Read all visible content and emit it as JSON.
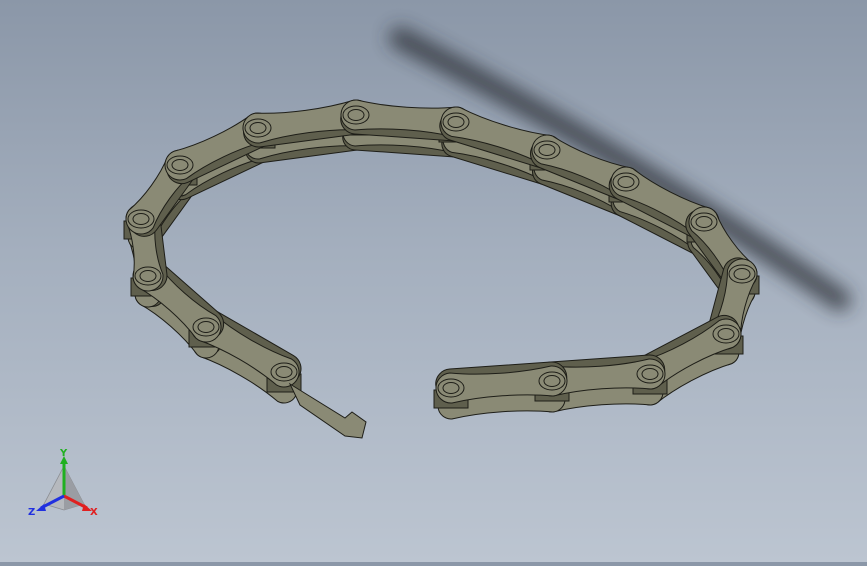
{
  "scene": {
    "model": "roller-chain",
    "links": 18,
    "background_top": "#8b97a8",
    "background_bottom": "#bcc5d1",
    "part_color": "#8a8a75",
    "part_side_color": "#5f5f4d",
    "edge_color": "#1e1e18"
  },
  "triad": {
    "x_label": "X",
    "y_label": "Y",
    "z_label": "Z",
    "x_color": "#e02020",
    "y_color": "#20b020",
    "z_color": "#2030e0"
  }
}
